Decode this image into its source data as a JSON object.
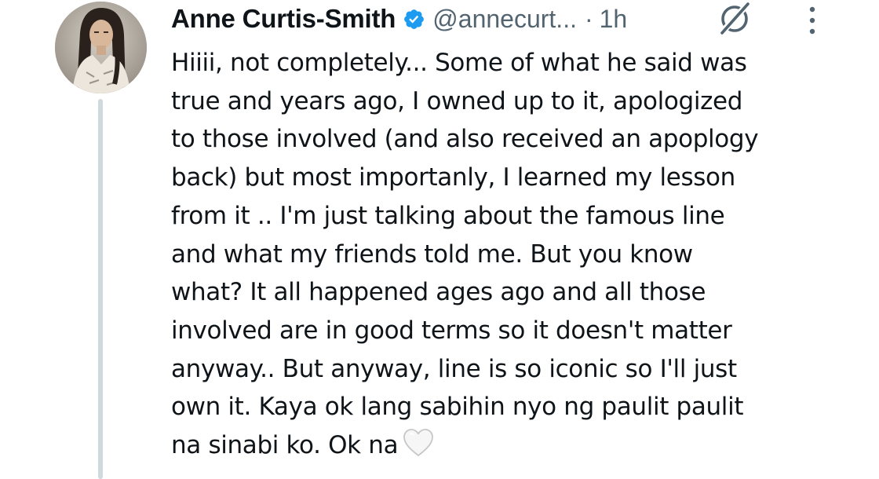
{
  "tweet": {
    "author_name": "Anne Curtis-Smith",
    "handle": "@annecurt...",
    "separator": "·",
    "time": "1h",
    "text": "Hiiii, not completely... Some of what he said was\ntrue and years ago, I owned up to it, apologized\nto those involved (and also received an apoplogy\nback) but most importanly, I learned my lesson\nfrom it .. I'm just talking about the famous line\nand what my friends told me. But you know\nwhat? It all happened ages ago and all those\ninvolved are in good terms so it doesn't matter\nanyway.. But anyway, line is so iconic so I'll just\nown it. Kaya ok lang sabihin nyo ng paulit paulit\nna sinabi ko. Ok na",
    "trailing_emoji": "white-heart"
  },
  "icons": {
    "verified": "verified-badge-icon",
    "grok": "grok-icon",
    "more": "more-vertical-icon"
  },
  "colors": {
    "verified_blue": "#1d9bf0",
    "secondary_text": "#536471",
    "primary_text": "#0f1419",
    "thread_line": "#cfd9de"
  }
}
